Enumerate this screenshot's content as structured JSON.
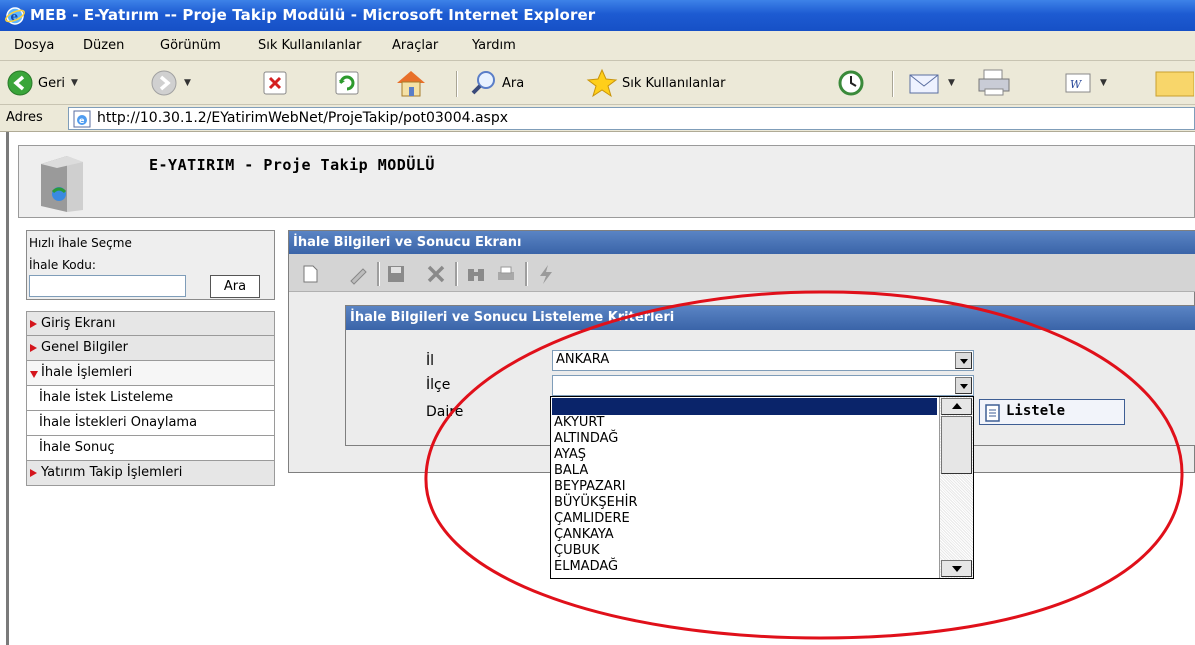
{
  "window": {
    "title": "MEB - E-Yatırım -- Proje Takip Modülü - Microsoft Internet Explorer"
  },
  "menubar": {
    "items": [
      "Dosya",
      "Düzen",
      "Görünüm",
      "Sık Kullanılanlar",
      "Araçlar",
      "Yardım"
    ]
  },
  "toolbar": {
    "back_label": "Geri",
    "search_label": "Ara",
    "favorites_label": "Sık Kullanılanlar"
  },
  "address": {
    "label": "Adres",
    "url": "http://10.30.1.2/EYatirimWebNet/ProjeTakip/pot03004.aspx"
  },
  "app": {
    "title": "E-YATIRIM - Proje Takip MODÜLÜ"
  },
  "quick_select": {
    "title": "Hızlı İhale Seçme",
    "code_label": "İhale Kodu:",
    "code_value": "",
    "button": "Ara"
  },
  "left_menu": {
    "items": [
      {
        "label": "Giriş Ekranı"
      },
      {
        "label": "Genel Bilgiler"
      },
      {
        "label": "İhale İşlemleri"
      },
      {
        "label": "İhale İstek Listeleme"
      },
      {
        "label": "İhale İstekleri Onaylama"
      },
      {
        "label": "İhale Sonuç"
      },
      {
        "label": "Yatırım Takip İşlemleri"
      }
    ]
  },
  "main": {
    "title": "İhale Bilgileri ve Sonucu Ekranı",
    "criteria_title": "İhale Bilgileri ve Sonucu Listeleme Kriterleri",
    "il_label": "İl",
    "il_value": "ANKARA",
    "ilce_label": "İlçe",
    "ilce_value": "",
    "daire_label": "Daire",
    "list_button": "Listele"
  },
  "ilce_options": [
    "",
    "AKYURT",
    "ALTINDAĞ",
    "AYAŞ",
    "BALA",
    "BEYPAZARI",
    "BÜYÜKŞEHİR",
    "ÇAMLIDERE",
    "ÇANKAYA",
    "ÇUBUK",
    "ELMADAĞ"
  ],
  "colors": {
    "panel_header": "#3a64a8",
    "annotation": "#e0101a",
    "selected_option": "#0a246a"
  }
}
